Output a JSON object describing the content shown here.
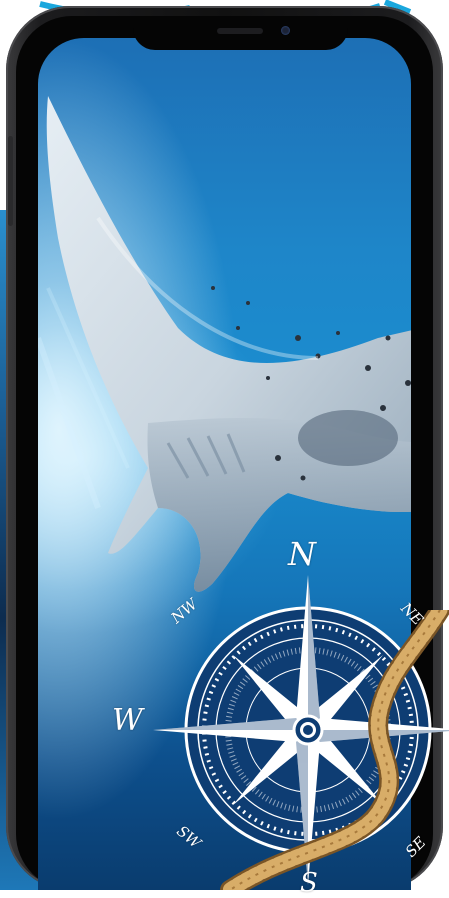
{
  "image": {
    "subject": "manta-ray-photo",
    "device": "smartphone"
  },
  "compass": {
    "north": "N",
    "northeast": "NE",
    "east": "",
    "southeast": "SE",
    "south": "S",
    "southwest": "SW",
    "west": "W",
    "northwest": "NW"
  },
  "colors": {
    "ocean": "#1a8ed0",
    "compass_fill": "#0e3d73",
    "compass_lines": "#ffffff",
    "rope": "#c79a55",
    "frame": "#1c1c1e"
  },
  "icons": [
    "compass-rose-icon",
    "rope-icon",
    "notch-camera-icon"
  ]
}
